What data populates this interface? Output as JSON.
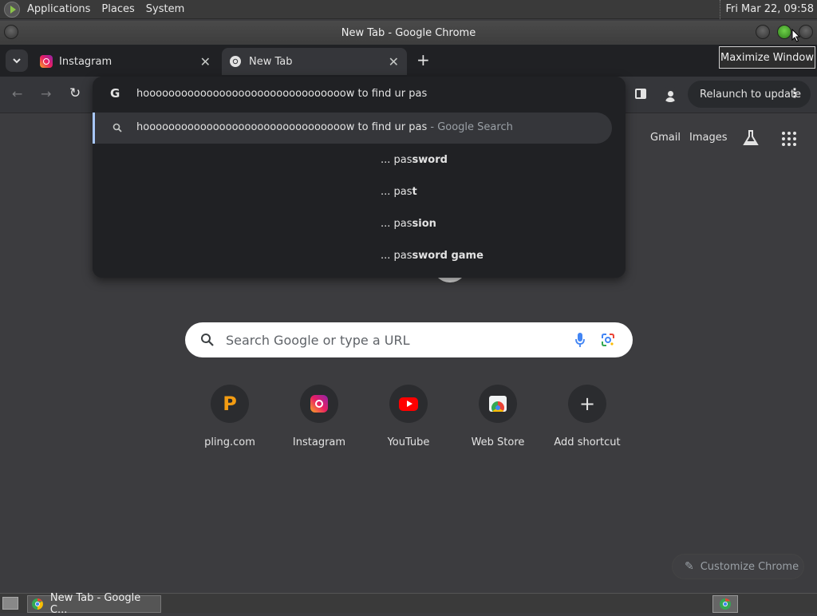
{
  "panel": {
    "menus": [
      "Applications",
      "Places",
      "System"
    ],
    "clock": "Fri Mar 22, 09:58"
  },
  "window": {
    "title": "New Tab - Google Chrome",
    "tooltip": "Maximize Window"
  },
  "tabs": [
    {
      "label": "Instagram",
      "active": false
    },
    {
      "label": "New Tab",
      "active": true
    }
  ],
  "toolbar": {
    "omnibox_text": "hoooooooooooooooooooooooooooooooow to find ur pas",
    "relaunch_label": "Relaunch to update"
  },
  "omnibox": {
    "search_suggestion": "hoooooooooooooooooooooooooooooooow to find ur pas",
    "search_suffix": " - Google Search",
    "suggestions": [
      {
        "prefix": "... pas",
        "rest": "sword"
      },
      {
        "prefix": "... pas",
        "rest": "t"
      },
      {
        "prefix": "... pas",
        "rest": "sion"
      },
      {
        "prefix": "... pas",
        "rest": "sword game"
      }
    ]
  },
  "ntp": {
    "links": [
      "Gmail",
      "Images"
    ],
    "search_placeholder": "Search Google or type a URL",
    "shortcuts": [
      {
        "label": "pling.com",
        "icon": "pling-icon"
      },
      {
        "label": "Instagram",
        "icon": "instagram-icon"
      },
      {
        "label": "YouTube",
        "icon": "youtube-icon"
      },
      {
        "label": "Web Store",
        "icon": "web-store-icon"
      },
      {
        "label": "Add shortcut",
        "icon": "plus-icon"
      }
    ],
    "customize_label": "Customize Chrome"
  },
  "taskbar": {
    "task_label": "New Tab - Google C..."
  }
}
